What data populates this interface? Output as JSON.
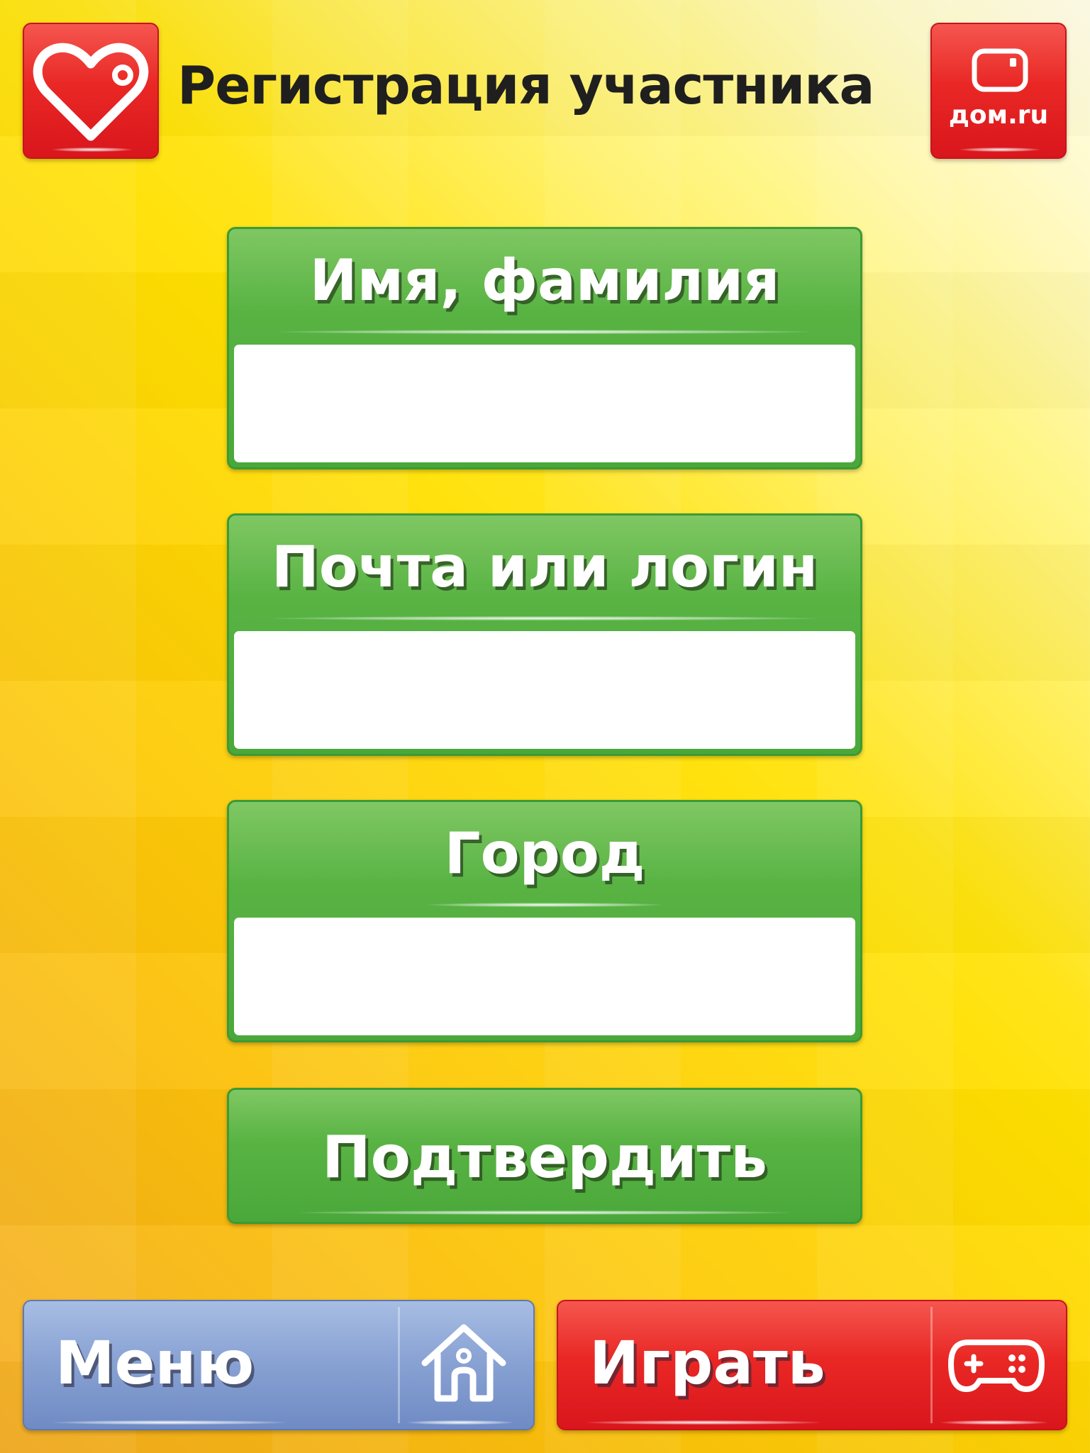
{
  "header": {
    "title": "Регистрация участника",
    "favorite_icon": "heart-icon",
    "brand_logo_text": "дом.ru",
    "brand_icon": "tv-icon"
  },
  "form": {
    "fields": [
      {
        "label": "Имя, фамилия",
        "value": "",
        "placeholder": ""
      },
      {
        "label": "Почта или логин",
        "value": "",
        "placeholder": ""
      },
      {
        "label": "Город",
        "value": "",
        "placeholder": ""
      }
    ],
    "confirm_label": "Подтвердить"
  },
  "footer": {
    "menu_label": "Меню",
    "menu_icon": "home-icon",
    "play_label": "Играть",
    "play_icon": "gamepad-icon"
  },
  "colors": {
    "red": "#e92825",
    "green": "#58b343",
    "blue": "#8aa3d4",
    "yellow": "#ffe000"
  }
}
